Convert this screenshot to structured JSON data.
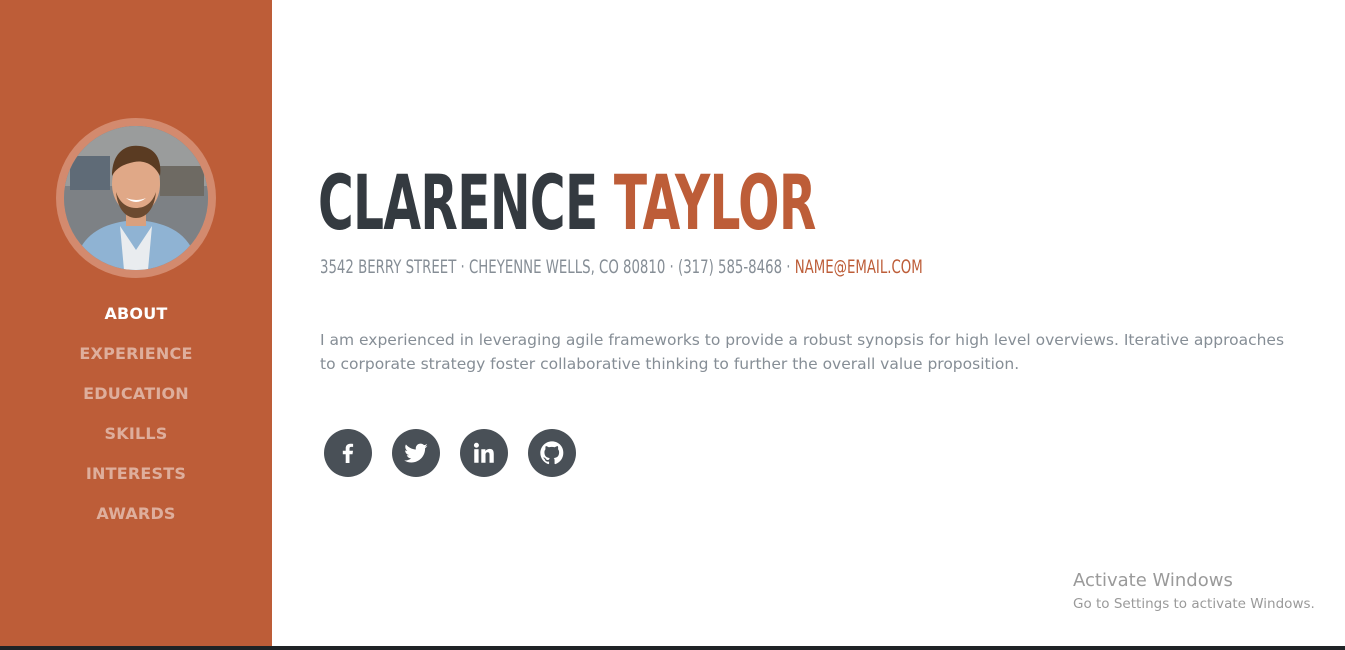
{
  "profile": {
    "first_name": "CLARENCE",
    "last_name": "TAYLOR",
    "address": "3542 BERRY STREET · CHEYENNE WELLS, CO 80810 · (317) 585-8468 ·",
    "email": "NAME@EMAIL.COM",
    "about": "I am experienced in leveraging agile frameworks to provide a robust synopsis for high level overviews. Iterative approaches to corporate strategy foster collaborative thinking to further the overall value proposition."
  },
  "sidebar": {
    "items": [
      {
        "label": "ABOUT",
        "active": true
      },
      {
        "label": "EXPERIENCE",
        "active": false
      },
      {
        "label": "EDUCATION",
        "active": false
      },
      {
        "label": "SKILLS",
        "active": false
      },
      {
        "label": "INTERESTS",
        "active": false
      },
      {
        "label": "AWARDS",
        "active": false
      }
    ]
  },
  "social": [
    {
      "icon": "facebook-icon"
    },
    {
      "icon": "twitter-icon"
    },
    {
      "icon": "linkedin-icon"
    },
    {
      "icon": "github-icon"
    }
  ],
  "watermark": {
    "title": "Activate Windows",
    "subtitle": "Go to Settings to activate Windows."
  },
  "colors": {
    "primary": "#bd5d38",
    "dark": "#343a40",
    "muted": "#868e96",
    "icon_bg": "#495057"
  }
}
